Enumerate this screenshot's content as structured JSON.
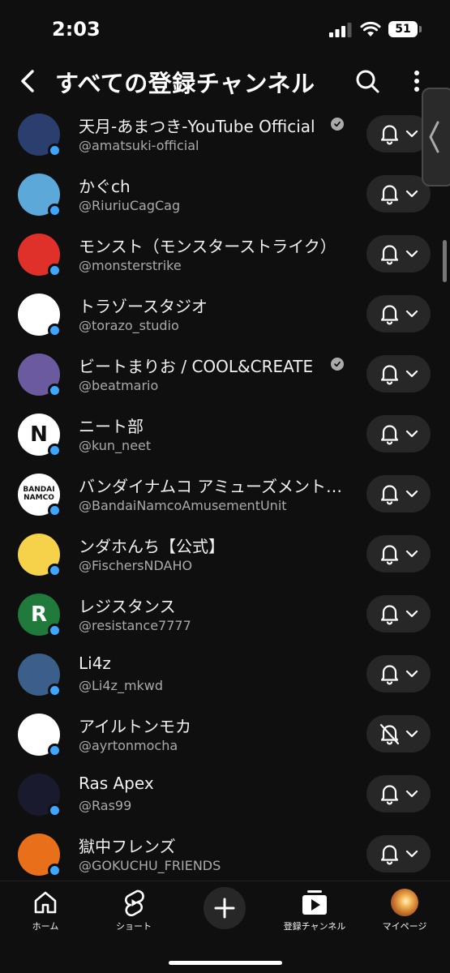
{
  "status": {
    "time": "2:03",
    "battery": "51"
  },
  "header": {
    "title": "すべての登録チャンネル"
  },
  "colors": {
    "accent": "#3ea6ff",
    "background": "#0f0f0f",
    "button": "#272727"
  },
  "channels": [
    {
      "name": "天月-あまつき-YouTube Official",
      "handle": "@amatsuki-official",
      "verified": true,
      "notifications": "on",
      "avatar_text": "",
      "avatar_bg": "#2b3f6e"
    },
    {
      "name": "かぐch",
      "handle": "@RiuriuCagCag",
      "verified": false,
      "notifications": "on",
      "avatar_text": "",
      "avatar_bg": "#5ca9d9"
    },
    {
      "name": "モンスト（モンスターストライク）",
      "handle": "@monsterstrike",
      "verified": false,
      "notifications": "on",
      "avatar_text": "",
      "avatar_bg": "#e0302a"
    },
    {
      "name": "トラゾースタジオ",
      "handle": "@torazo_studio",
      "verified": false,
      "notifications": "on",
      "avatar_text": "",
      "avatar_bg": "#ffffff"
    },
    {
      "name": "ビートまりお / COOL&CREATE",
      "handle": "@beatmario",
      "verified": true,
      "notifications": "on",
      "avatar_text": "",
      "avatar_bg": "#6b5a9e"
    },
    {
      "name": " ニート部",
      "handle": "@kun_neet",
      "verified": false,
      "notifications": "on",
      "avatar_text": "N",
      "avatar_bg": "#ffffff"
    },
    {
      "name": "バンダイナムコ アミューズメントユニット",
      "handle": "@BandaiNamcoAmusementUnit",
      "verified": false,
      "notifications": "on",
      "avatar_text": "BANDAI NAMCO",
      "avatar_bg": "#ffffff"
    },
    {
      "name": "ンダホんち【公式】",
      "handle": "@FischersNDAHO",
      "verified": false,
      "notifications": "on",
      "avatar_text": "",
      "avatar_bg": "#f5d24a"
    },
    {
      "name": "レジスタンス",
      "handle": "@resistance7777",
      "verified": false,
      "notifications": "on",
      "avatar_text": "R",
      "avatar_bg": "#1f7a3c"
    },
    {
      "name": "Li4z",
      "handle": "@Li4z_mkwd",
      "verified": false,
      "notifications": "on",
      "avatar_text": "",
      "avatar_bg": "#3b5f8a"
    },
    {
      "name": "アイルトンモカ",
      "handle": "@ayrtonmocha",
      "verified": false,
      "notifications": "off",
      "avatar_text": "",
      "avatar_bg": "#ffffff"
    },
    {
      "name": "Ras Apex",
      "handle": "@Ras99",
      "verified": false,
      "notifications": "on",
      "avatar_text": "",
      "avatar_bg": "#1a1a2e"
    },
    {
      "name": "獄中フレンズ",
      "handle": "@GOKUCHU_FRIENDS",
      "verified": false,
      "notifications": "on",
      "avatar_text": "",
      "avatar_bg": "#e8701a"
    }
  ],
  "nav": {
    "home": "ホーム",
    "shorts": "ショート",
    "subscriptions": "登録チャンネル",
    "you": "マイページ"
  }
}
